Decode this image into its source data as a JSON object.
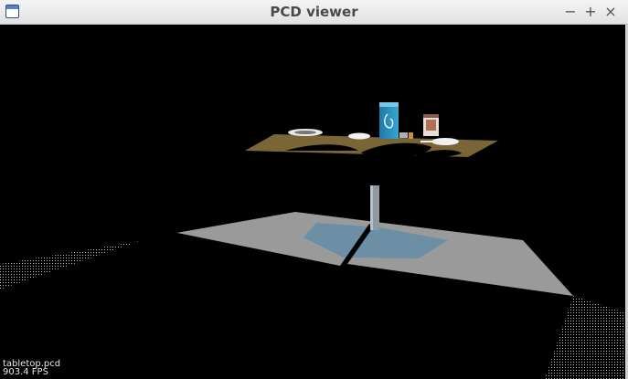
{
  "window": {
    "title": "PCD viewer",
    "controls": {
      "minimize": "−",
      "maximize": "+",
      "close": "×"
    }
  },
  "viewport": {
    "filename": "tabletop.pcd",
    "fps": "903.4 FPS",
    "background_color": "#000000",
    "floor_color": "#9a9a9a",
    "table_color": "#7a6536",
    "shadow_color": "#6c8fa6"
  }
}
